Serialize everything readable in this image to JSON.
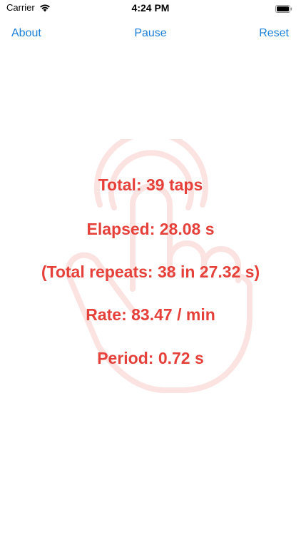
{
  "status_bar": {
    "carrier": "Carrier",
    "time": "4:24 PM",
    "icons": [
      "wifi-icon",
      "battery-icon"
    ]
  },
  "nav": {
    "about_label": "About",
    "pause_label": "Pause",
    "reset_label": "Reset",
    "accent_color": "#1a7fd8"
  },
  "stats": {
    "total": "Total: 39 taps",
    "elapsed": "Elapsed: 28.08 s",
    "total_repeats": "(Total repeats: 38 in 27.32 s)",
    "rate": "Rate: 83.47 / min",
    "period": "Period: 0.72 s",
    "text_color": "#e5403a"
  },
  "background": {
    "icon": "tap-hand-icon",
    "icon_color": "#fbe3e1"
  }
}
